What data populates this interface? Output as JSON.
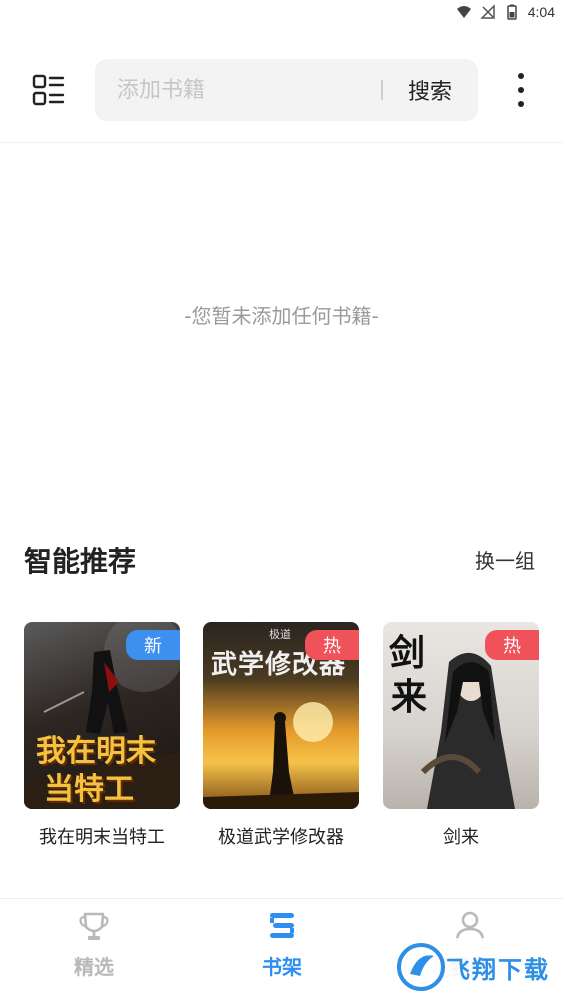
{
  "status_bar": {
    "time": "4:04"
  },
  "search": {
    "placeholder": "添加书籍",
    "button_label": "搜索"
  },
  "shelf": {
    "empty_text": "-您暂未添加任何书籍-"
  },
  "recommend": {
    "title": "智能推荐",
    "refresh_label": "换一组",
    "books": [
      {
        "title": "我在明末当特工",
        "tag": "新",
        "tag_color": "#3d8ff0",
        "cover_text_1": "我在明末",
        "cover_text_2": "当特工"
      },
      {
        "title": "极道武学修改器",
        "tag": "热",
        "tag_color": "#f0525a",
        "cover_text_1": "武学修改器",
        "cover_small": "极道"
      },
      {
        "title": "剑来",
        "tag": "热",
        "tag_color": "#f0525a",
        "cover_text_1": "剑",
        "cover_text_2": "来"
      }
    ]
  },
  "tabs": [
    {
      "label": "精选",
      "icon": "trophy-icon",
      "active": false
    },
    {
      "label": "书架",
      "icon": "bookshelf-icon",
      "active": true,
      "color": "#2f8ff0"
    },
    {
      "label": "我的",
      "icon": "user-icon",
      "active": false
    }
  ],
  "watermark": {
    "text": "飞翔下载"
  },
  "colors": {
    "accent": "#2f8ff0",
    "inactive": "#b9b9b9"
  }
}
